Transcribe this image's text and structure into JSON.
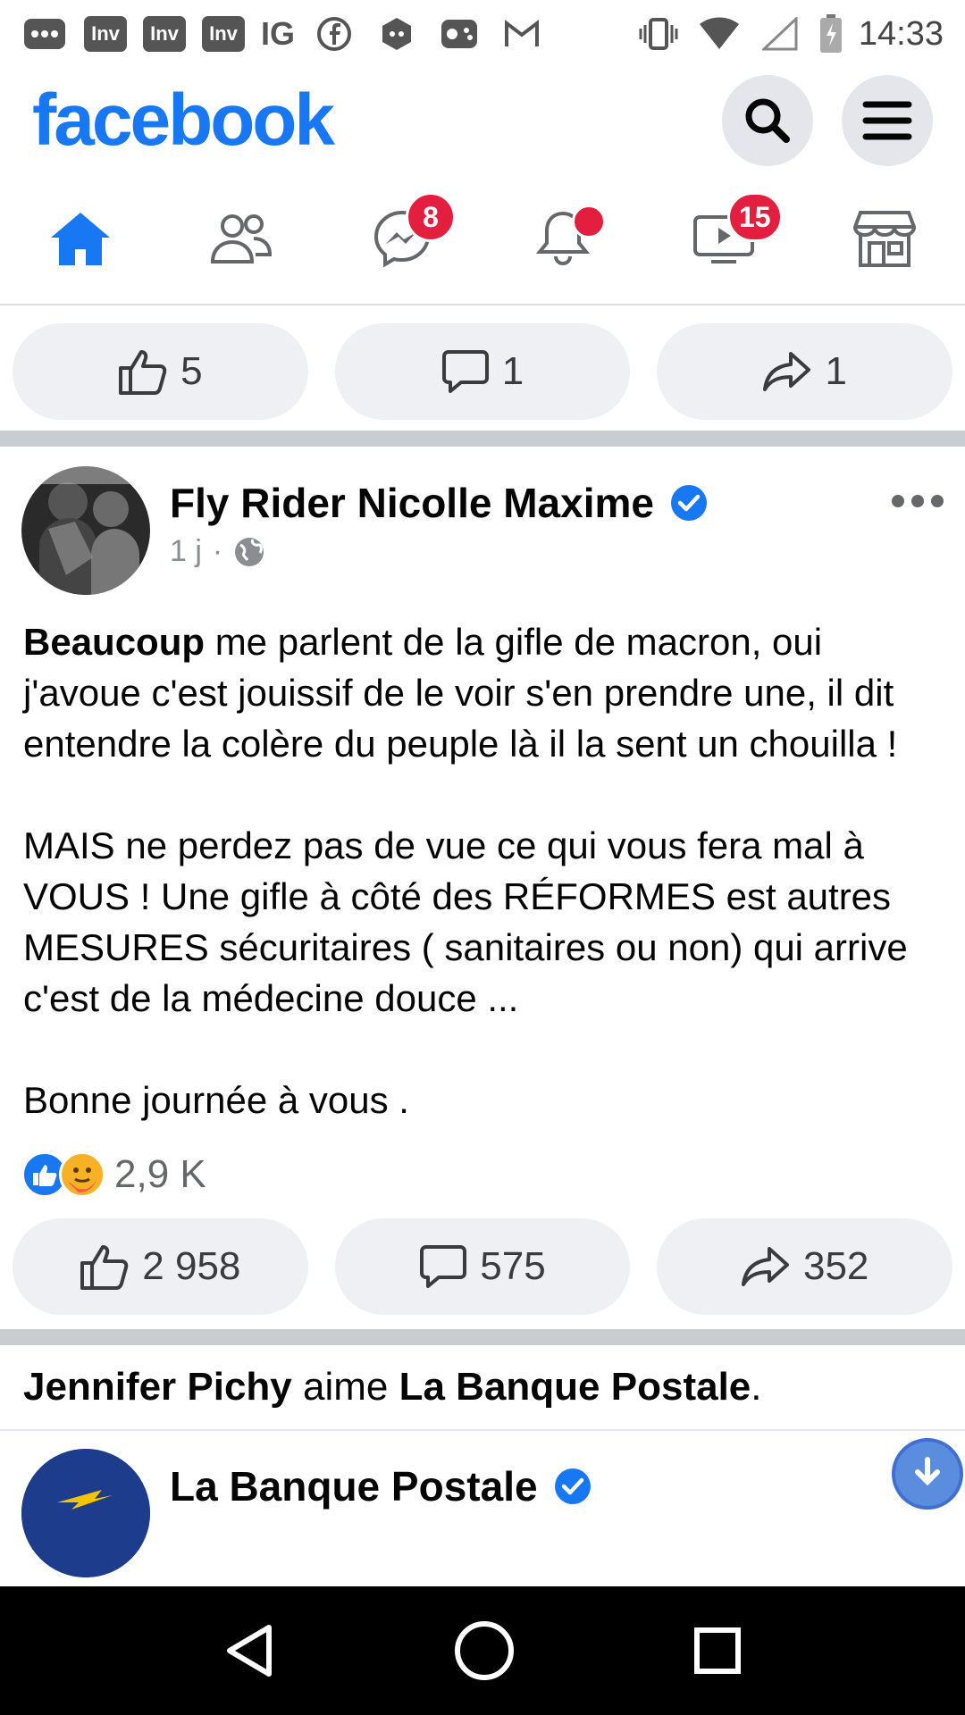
{
  "status_bar": {
    "notification_badges": [
      "Inv",
      "Inv",
      "Inv"
    ],
    "ig_label": "IG",
    "time": "14:33"
  },
  "header": {
    "logo": "facebook"
  },
  "tabs": {
    "messenger_badge": "8",
    "watch_badge": "15"
  },
  "previous_post_actions": {
    "likes": "5",
    "comments": "1",
    "shares": "1"
  },
  "post": {
    "author": "Fly Rider Nicolle Maxime",
    "time": "1 j",
    "separator": "·",
    "body_lead_bold": "Beaucoup",
    "body_p1_rest": " me parlent de la gifle de macron, oui j'avoue c'est jouissif de le voir s'en prendre une, il dit entendre la colère du peuple là il la sent un chouilla !",
    "body_p2": "MAIS ne perdez pas de vue ce qui vous fera mal à VOUS ! Une gifle à côté des RÉFORMES est autres MESURES sécuritaires ( sanitaires ou non) qui arrive c'est de la médecine douce ...",
    "body_p3": "Bonne journée à vous .",
    "reaction_count": "2,9 K",
    "likes": "2 958",
    "comments": "575",
    "shares": "352"
  },
  "activity": {
    "person": "Jennifer Pichy",
    "verb": " aime ",
    "page": "La Banque Postale",
    "end": "."
  },
  "post2": {
    "author": "La Banque Postale"
  },
  "colors": {
    "brand_blue": "#1877f2",
    "badge_red": "#e41e3f"
  }
}
